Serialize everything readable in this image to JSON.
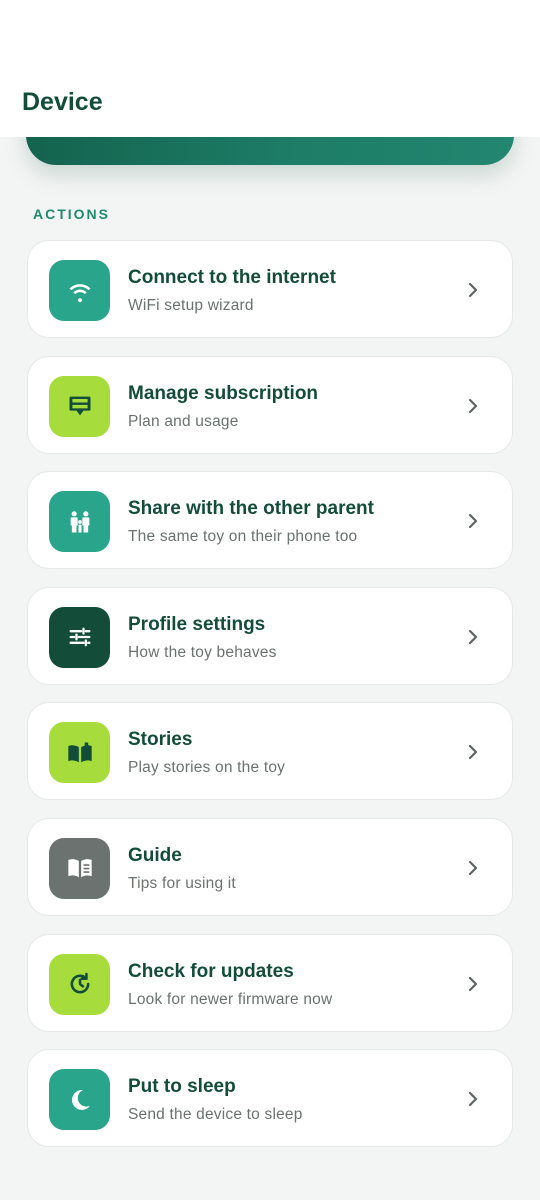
{
  "header": {
    "title": "Device"
  },
  "section": {
    "label": "ACTIONS"
  },
  "actions": [
    {
      "title": "Connect to the internet",
      "subtitle": "WiFi setup wizard",
      "icon": "wifi-icon",
      "color": "#28a58a"
    },
    {
      "title": "Manage subscription",
      "subtitle": "Plan and usage",
      "icon": "subscription-card-icon",
      "color": "#a6dc3c"
    },
    {
      "title": "Share with the other parent",
      "subtitle": "The same toy on their phone too",
      "icon": "family-icon",
      "color": "#28a58a"
    },
    {
      "title": "Profile settings",
      "subtitle": "How the toy behaves",
      "icon": "sliders-icon",
      "color": "#134d3a"
    },
    {
      "title": "Stories",
      "subtitle": "Play stories on the toy",
      "icon": "open-book-icon",
      "color": "#a6dc3c"
    },
    {
      "title": "Guide",
      "subtitle": "Tips for using it",
      "icon": "guide-book-icon",
      "color": "#6b726f"
    },
    {
      "title": "Check for updates",
      "subtitle": "Look for newer firmware now",
      "icon": "update-clock-icon",
      "color": "#a6dc3c"
    },
    {
      "title": "Put to sleep",
      "subtitle": "Send the device to sleep",
      "icon": "moon-icon",
      "color": "#28a58a"
    }
  ],
  "colors": {
    "brand_dark": "#134d3a",
    "brand_teal": "#28a58a",
    "accent_lime": "#a6dc3c",
    "neutral_gray": "#6b726f"
  }
}
